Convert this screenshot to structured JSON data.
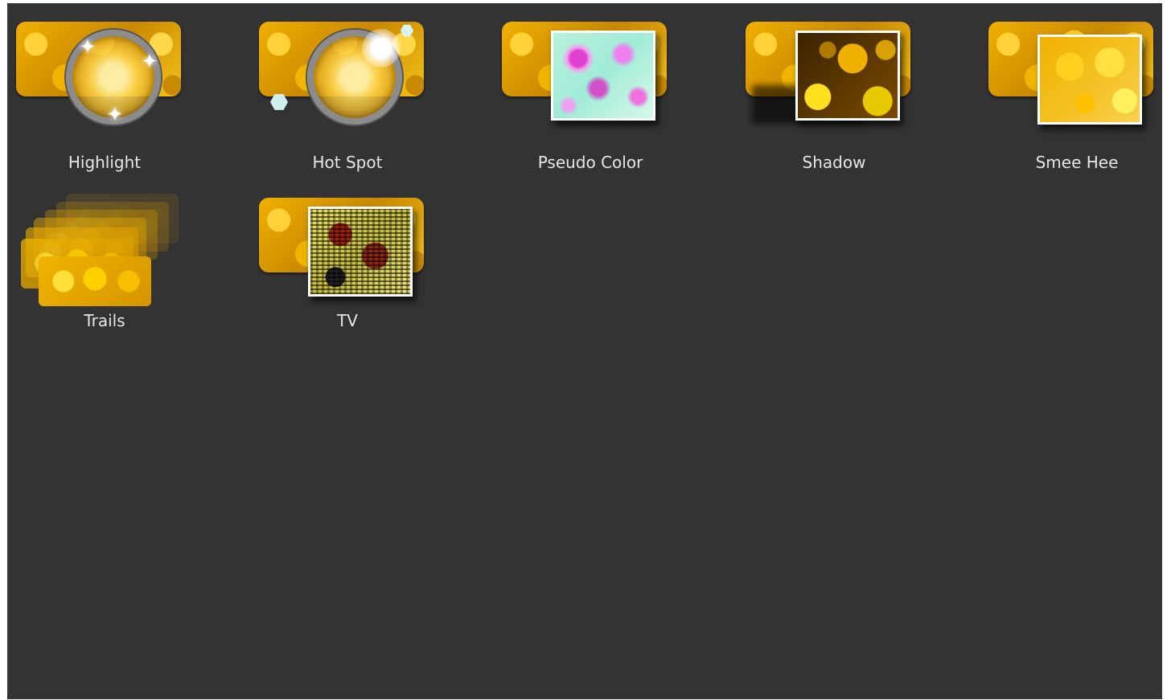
{
  "effects": [
    {
      "label": "Highlight"
    },
    {
      "label": "Hot Spot"
    },
    {
      "label": "Pseudo Color"
    },
    {
      "label": "Shadow"
    },
    {
      "label": "Smee Hee"
    },
    {
      "label": "Trails"
    },
    {
      "label": "TV"
    }
  ],
  "colors": {
    "panel_background": "#333333",
    "label_text": "#e6e6e6",
    "fruit_accent": "#f0b000"
  },
  "icons": [
    "highlight-icon",
    "hot-spot-icon",
    "pseudo-color-icon",
    "shadow-icon",
    "smee-hee-icon",
    "trails-icon",
    "tv-icon"
  ]
}
